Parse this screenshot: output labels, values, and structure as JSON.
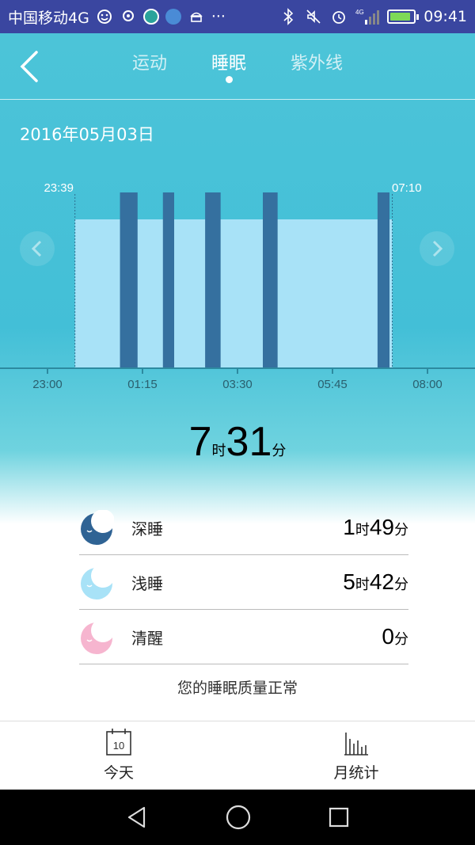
{
  "status_bar": {
    "carrier": "中国移动4G",
    "time": "09:41",
    "network": "4G",
    "battery_level": 0.9
  },
  "nav": {
    "tabs": [
      "运动",
      "睡眠",
      "紫外线"
    ],
    "active_tab": "睡眠"
  },
  "date": "2016年05月03日",
  "chart_data": {
    "type": "bar",
    "start_label": "23:39",
    "end_label": "07:10",
    "x_ticks": [
      "23:00",
      "01:15",
      "03:30",
      "05:45",
      "08:00"
    ],
    "x_range": [
      "23:00",
      "08:00"
    ],
    "light_sleep": {
      "start": "23:39",
      "end": "07:10"
    },
    "deep_sleep_segments": [
      {
        "start": "00:43",
        "end": "01:08"
      },
      {
        "start": "01:44",
        "end": "02:00"
      },
      {
        "start": "02:44",
        "end": "03:06"
      },
      {
        "start": "04:06",
        "end": "04:27"
      },
      {
        "start": "06:49",
        "end": "07:06"
      }
    ],
    "colors": {
      "light": "#a8e2f7",
      "deep": "#35709f"
    }
  },
  "total": {
    "hours": "7",
    "hours_unit": "时",
    "minutes": "31",
    "minutes_unit": "分"
  },
  "stages": [
    {
      "name": "深睡",
      "hours": "1",
      "minutes": "49",
      "icon": "moon-deep-icon",
      "color": "#2f6394"
    },
    {
      "name": "浅睡",
      "hours": "5",
      "minutes": "42",
      "icon": "moon-light-icon",
      "color": "#a8e2f7"
    },
    {
      "name": "清醒",
      "minutes": "0",
      "icon": "moon-awake-icon",
      "color": "#f6b5cf"
    }
  ],
  "units": {
    "hour": "时",
    "minute": "分"
  },
  "quality_text": "您的睡眠质量正常",
  "bottom_tabs": [
    {
      "label": "今天",
      "icon": "calendar-icon",
      "calendar_day": "10"
    },
    {
      "label": "月统计",
      "icon": "bar-chart-icon"
    }
  ]
}
